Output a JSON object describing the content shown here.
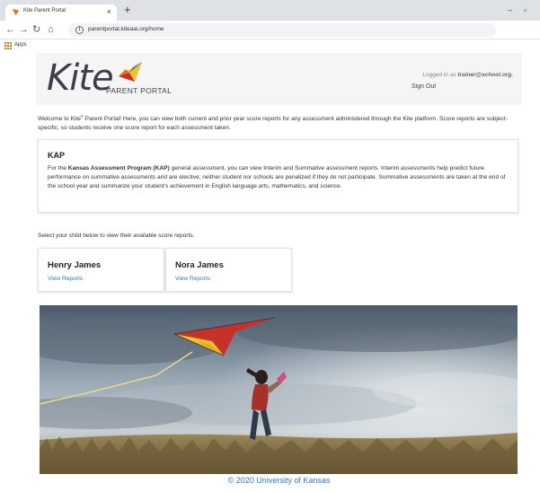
{
  "browser": {
    "tab_title": "Kite Parent Portal",
    "tab_close_glyph": "×",
    "new_tab_glyph": "+",
    "minimize_glyph": "–",
    "maximize_glyph": "▫",
    "back_glyph": "←",
    "forward_glyph": "→",
    "reload_glyph": "↻",
    "home_glyph": "⌂",
    "url": "parentportal.kiteaai.org/home",
    "bookmarks_label": "Apps"
  },
  "header": {
    "logo_word": "Kite",
    "logo_subtitle": "PARENT PORTAL",
    "logged_in_prefix": "Logged in as ",
    "logged_in_user": "trainer@school.org.",
    "sign_out_label": "Sign Out"
  },
  "welcome": {
    "part1": "Welcome to Kite",
    "reg_mark": "®",
    "part2": " Parent Portal! Here, you can view both current and prior year score reports for any assessment administered through the Kite platform. Score reports are subject-specific, so students receive one score report for each assessment taken."
  },
  "kap": {
    "title": "KAP",
    "body_prefix": "For the ",
    "body_bold": "Kansas Assessment Program (KAP)",
    "body_rest": " general assessment, you can view Interim and Summative assessment reports. Interim assessments help predict future performance on summative assessments and are elective; neither student nor schools are penalized if they do not participate. Summative assessments are taken at the end of the school year and summarize your student's achievement in English language arts, mathematics, and science."
  },
  "select_child_text": "Select your child below to view their available score reports.",
  "children": [
    {
      "name": "Henry James",
      "link_label": "View Reports"
    },
    {
      "name": "Nora James",
      "link_label": "View Reports"
    }
  ],
  "footer_text": "© 2020 University of Kansas",
  "colors": {
    "link": "#2a7bd4",
    "header_bg": "#f5f5f5",
    "tabbar_bg": "#dee1e6",
    "kite_yellow": "#f2c12e",
    "kite_red": "#c8312b",
    "kite_blue": "#2a6fb5"
  }
}
